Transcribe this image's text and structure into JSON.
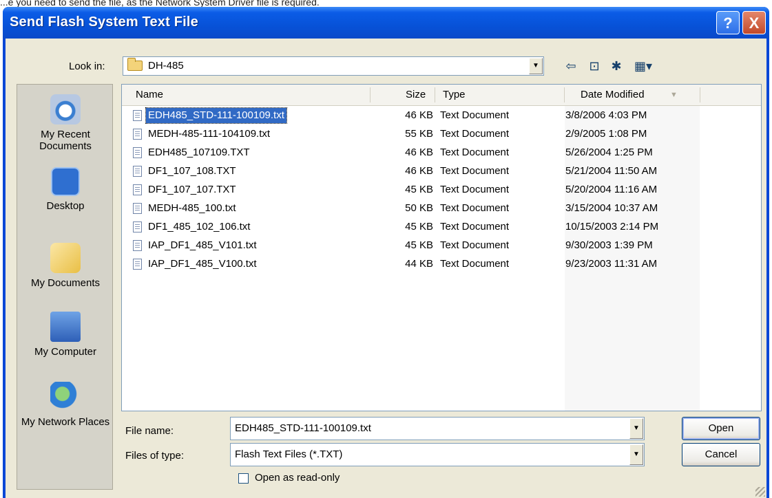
{
  "top_text": "...e you need to send the file, as the Network System Driver file is required.",
  "title": "Send Flash System Text File",
  "help_btn": "?",
  "close_btn": "X",
  "lookin": {
    "label": "Look in:",
    "value": "DH-485"
  },
  "toolbar_icons": [
    "back-icon",
    "up-folder-icon",
    "new-folder-icon",
    "view-menu-icon"
  ],
  "places": [
    {
      "label": "My Recent Documents",
      "icon": "recent-documents-icon"
    },
    {
      "label": "Desktop",
      "icon": "desktop-icon"
    },
    {
      "label": "My Documents",
      "icon": "my-documents-icon"
    },
    {
      "label": "My Computer",
      "icon": "my-computer-icon"
    },
    {
      "label": "My Network Places",
      "icon": "network-places-icon"
    }
  ],
  "columns": {
    "name": "Name",
    "size": "Size",
    "type": "Type",
    "date": "Date Modified"
  },
  "files": [
    {
      "name": "EDH485_STD-111-100109.txt",
      "size": "46 KB",
      "type": "Text Document",
      "date": "3/8/2006 4:03 PM",
      "selected": true
    },
    {
      "name": "MEDH-485-111-104109.txt",
      "size": "55 KB",
      "type": "Text Document",
      "date": "2/9/2005 1:08 PM"
    },
    {
      "name": "EDH485_107109.TXT",
      "size": "46 KB",
      "type": "Text Document",
      "date": "5/26/2004 1:25 PM"
    },
    {
      "name": "DF1_107_108.TXT",
      "size": "46 KB",
      "type": "Text Document",
      "date": "5/21/2004 11:50 AM"
    },
    {
      "name": "DF1_107_107.TXT",
      "size": "45 KB",
      "type": "Text Document",
      "date": "5/20/2004 11:16 AM"
    },
    {
      "name": "MEDH-485_100.txt",
      "size": "50 KB",
      "type": "Text Document",
      "date": "3/15/2004 10:37 AM"
    },
    {
      "name": "DF1_485_102_106.txt",
      "size": "45 KB",
      "type": "Text Document",
      "date": "10/15/2003 2:14 PM"
    },
    {
      "name": "IAP_DF1_485_V101.txt",
      "size": "45 KB",
      "type": "Text Document",
      "date": "9/30/2003 1:39 PM"
    },
    {
      "name": "IAP_DF1_485_V100.txt",
      "size": "44 KB",
      "type": "Text Document",
      "date": "9/23/2003 11:31 AM"
    }
  ],
  "filename": {
    "label": "File name:",
    "value": "EDH485_STD-111-100109.txt"
  },
  "filetype": {
    "label": "Files of type:",
    "value": "Flash Text Files (*.TXT)"
  },
  "readonly": {
    "label": "Open as read-only",
    "checked": false
  },
  "buttons": {
    "open": "Open",
    "cancel": "Cancel"
  },
  "colors": {
    "title_bar": "#0752d8",
    "dialog_bg": "#ece9d8",
    "selection": "#316ac5"
  }
}
